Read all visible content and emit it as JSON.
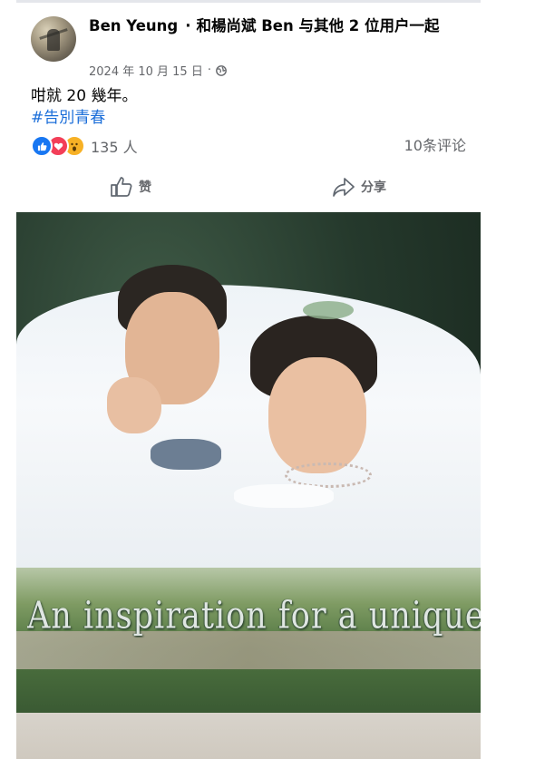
{
  "post": {
    "author": "Ben Yeung",
    "separator": "·",
    "with_text": "和楊尚斌 Ben 与其他 2 位用户一起",
    "date": "2024 年 10 月 15 日",
    "date_separator": "·",
    "privacy_icon": "globe-icon",
    "text": "咁就 20 幾年。",
    "hashtag": "#告別青春",
    "reactions": {
      "icons": [
        "like-reaction-icon",
        "love-reaction-icon",
        "wow-reaction-icon"
      ],
      "count": "135 人"
    },
    "comments": "10条评论",
    "actions": {
      "like_label": "赞",
      "share_label": "分享"
    },
    "photo": {
      "caption": "An inspiration for a unique mo"
    }
  },
  "colors": {
    "hashtag": "#1b6ed9",
    "secondary_text": "#65676b",
    "like_blue": "#1877f2",
    "love_red": "#f33e58",
    "wow_yellow": "#f7b125"
  }
}
